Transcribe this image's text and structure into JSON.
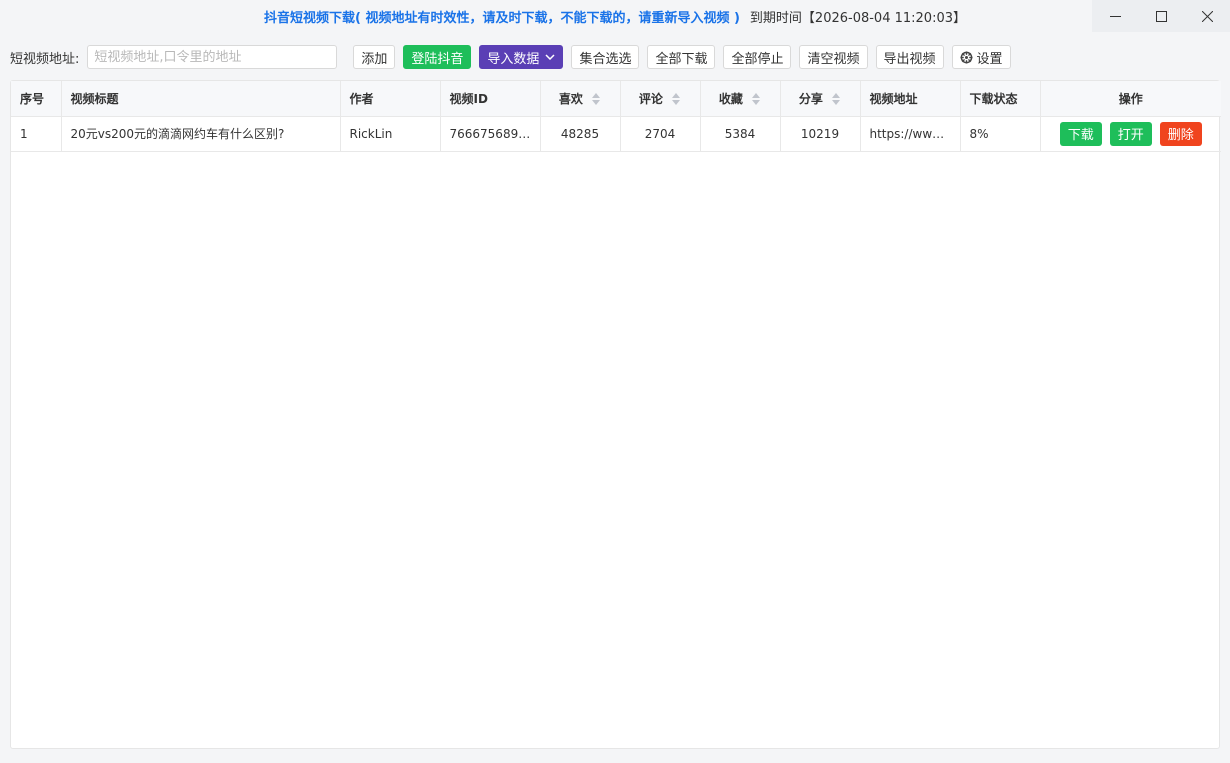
{
  "window": {
    "title": "抖音短视频下载( 视频地址有时效性，请及时下载，不能下载的，请重新导入视频 )",
    "expiry": "到期时间【2026-08-04 11:20:03】"
  },
  "toolbar": {
    "url_label": "短视频地址:",
    "url_placeholder": "短视频地址,口令里的地址",
    "url_value": "",
    "add_label": "添加",
    "login_label": "登陆抖音",
    "import_label": "导入数据",
    "select_collection_label": "集合选选",
    "download_all_label": "全部下载",
    "stop_all_label": "全部停止",
    "clear_label": "清空视频",
    "export_label": "导出视频",
    "settings_label": "设置"
  },
  "table": {
    "columns": [
      "序号",
      "视频标题",
      "作者",
      "视频ID",
      "喜欢",
      "评论",
      "收藏",
      "分享",
      "视频地址",
      "下载状态",
      "操作"
    ],
    "rows": [
      {
        "index": "1",
        "title": "20元vs200元的滴滴网约车有什么区别?",
        "author": "RickLin",
        "video_id": "7666756898...",
        "likes": "48285",
        "comments": "2704",
        "favorites": "5384",
        "shares": "10219",
        "url": "https://www....",
        "status": "8%",
        "actions": {
          "download": "下载",
          "open": "打开",
          "delete": "删除"
        }
      }
    ]
  },
  "colors": {
    "title_blue": "#1a73e8",
    "green": "#1ebe5a",
    "purple": "#5a3fb5",
    "red": "#f0441e"
  }
}
